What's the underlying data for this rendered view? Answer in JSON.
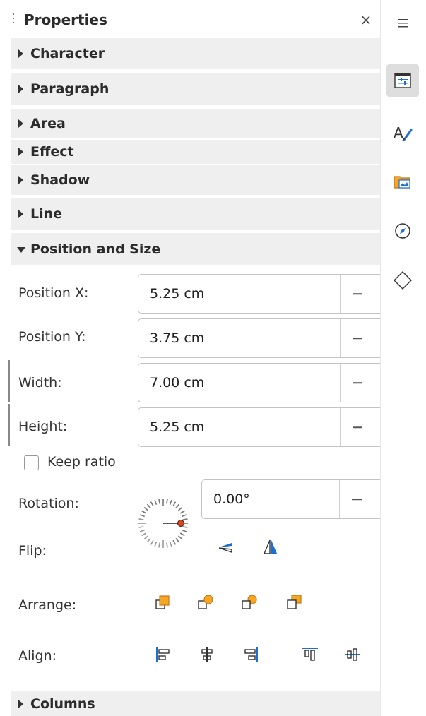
{
  "deck": {
    "title": "Properties",
    "close_icon": "close-icon"
  },
  "sections": {
    "character": "Character",
    "paragraph": "Paragraph",
    "area": "Area",
    "effect": "Effect",
    "shadow": "Shadow",
    "line": "Line",
    "position_size": "Position and Size",
    "columns": "Columns"
  },
  "position_size": {
    "position_x_label": "Position X:",
    "position_x_value": "5.25 cm",
    "position_y_label": "Position Y:",
    "position_y_value": "3.75 cm",
    "width_label": "Width:",
    "width_value": "7.00 cm",
    "height_label": "Height:",
    "height_value": "5.25 cm",
    "keep_ratio_label": "Keep ratio",
    "keep_ratio_checked": false,
    "rotation_label": "Rotation:",
    "rotation_value": "0.00°",
    "flip_label": "Flip:",
    "arrange_label": "Arrange:",
    "align_label": "Align:"
  },
  "tabbar": {
    "items": [
      {
        "icon": "menu-icon"
      },
      {
        "icon": "properties-icon",
        "active": true
      },
      {
        "icon": "styles-icon"
      },
      {
        "icon": "gallery-icon"
      },
      {
        "icon": "navigator-icon"
      },
      {
        "icon": "shapes-icon"
      }
    ]
  },
  "colors": {
    "section_bg": "#efefef",
    "accent_orange": "#f5a623",
    "accent_blue": "#1f6fd1",
    "dial_dot": "#e0421c"
  }
}
